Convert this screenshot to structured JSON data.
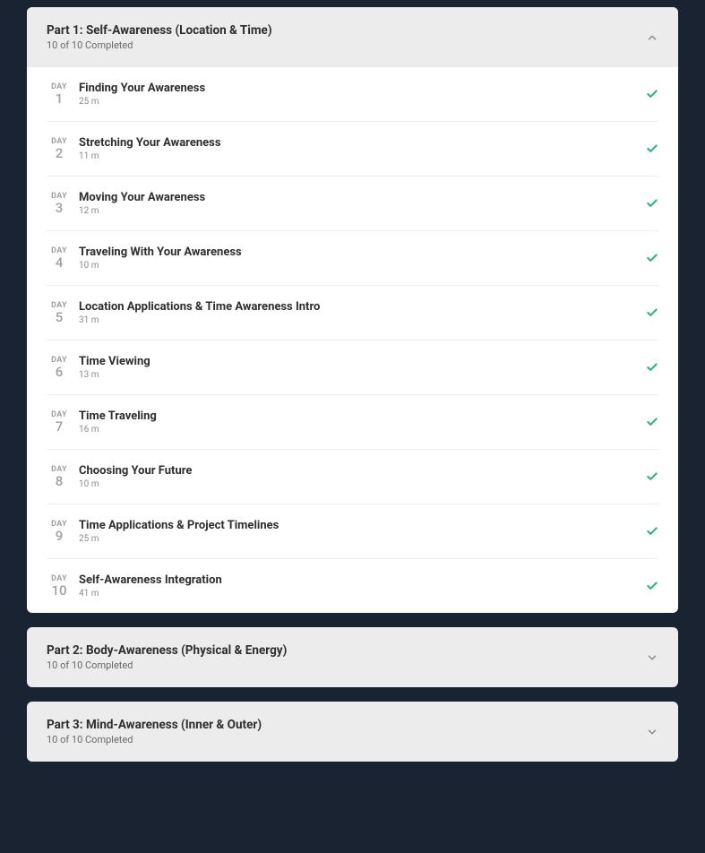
{
  "sections": [
    {
      "title": "Part 1: Self-Awareness (Location & Time)",
      "subtitle": "10 of 10 Completed",
      "expanded": true,
      "day_label": "DAY",
      "lessons": [
        {
          "day": "1",
          "title": "Finding Your Awareness",
          "duration": "25 m"
        },
        {
          "day": "2",
          "title": "Stretching Your Awareness",
          "duration": "11 m"
        },
        {
          "day": "3",
          "title": "Moving Your Awareness",
          "duration": "12 m"
        },
        {
          "day": "4",
          "title": "Traveling With Your Awareness",
          "duration": "10 m"
        },
        {
          "day": "5",
          "title": "Location Applications & Time Awareness Intro",
          "duration": "31 m"
        },
        {
          "day": "6",
          "title": "Time Viewing",
          "duration": "13 m"
        },
        {
          "day": "7",
          "title": "Time Traveling",
          "duration": "16 m"
        },
        {
          "day": "8",
          "title": "Choosing Your Future",
          "duration": "10 m"
        },
        {
          "day": "9",
          "title": "Time Applications & Project Timelines",
          "duration": "25 m"
        },
        {
          "day": "10",
          "title": "Self-Awareness Integration",
          "duration": "41 m"
        }
      ]
    },
    {
      "title": "Part 2: Body-Awareness (Physical & Energy)",
      "subtitle": "10 of 10 Completed",
      "expanded": false
    },
    {
      "title": "Part 3: Mind-Awareness (Inner & Outer)",
      "subtitle": "10 of 10 Completed",
      "expanded": false
    }
  ]
}
